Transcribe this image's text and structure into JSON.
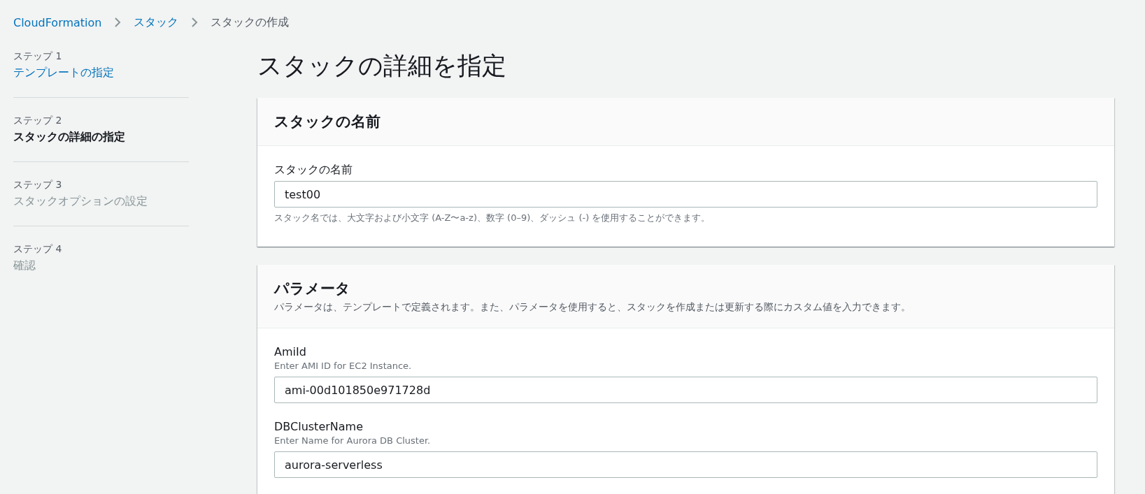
{
  "breadcrumbs": [
    {
      "label": "CloudFormation",
      "link": true
    },
    {
      "label": "スタック",
      "link": true
    },
    {
      "label": "スタックの作成",
      "link": false
    }
  ],
  "steps": [
    {
      "step": "ステップ 1",
      "title": "テンプレートの指定",
      "completed": true,
      "selected": false
    },
    {
      "step": "ステップ 2",
      "title": "スタックの詳細の指定",
      "completed": false,
      "selected": true
    },
    {
      "step": "ステップ 3",
      "title": "スタックオプションの設定",
      "completed": false,
      "selected": false
    },
    {
      "step": "ステップ 4",
      "title": "確認",
      "completed": false,
      "selected": false
    }
  ],
  "page_title": "スタックの詳細を指定",
  "sections": [
    {
      "title": "スタックの名前",
      "fields": [
        {
          "label": "スタックの名前",
          "value": "test00",
          "hint": "スタック名では、大文字および小文字 (A-Z〜a-z)、数字 (0–9)、ダッシュ (-) を使用することができます。"
        }
      ]
    },
    {
      "title": "パラメータ",
      "description": "パラメータは、テンプレートで定義されます。また、パラメータを使用すると、スタックを作成または更新する際にカスタム値を入力できます。",
      "fields": [
        {
          "label": "AmiId",
          "description": "Enter AMI ID for EC2 Instance.",
          "value": "ami-00d101850e971728d"
        },
        {
          "label": "DBClusterName",
          "description": "Enter Name for Aurora DB Cluster.",
          "value": "aurora-serverless"
        }
      ]
    }
  ]
}
